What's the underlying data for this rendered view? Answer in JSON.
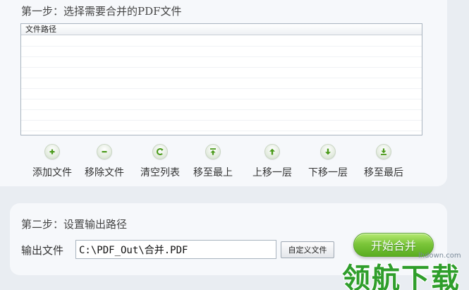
{
  "step1": {
    "title": "第一步：选择需要合并的PDF文件",
    "list": {
      "column_header": "文件路径",
      "rows": []
    },
    "actions": [
      {
        "icon": "plus-icon",
        "label": "添加文件"
      },
      {
        "icon": "minus-icon",
        "label": "移除文件"
      },
      {
        "icon": "refresh-icon",
        "label": "清空列表"
      },
      {
        "icon": "arrow-to-top-icon",
        "label": "移至最上"
      },
      {
        "icon": "arrow-up-icon",
        "label": "上移一层"
      },
      {
        "icon": "arrow-down-icon",
        "label": "下移一层"
      },
      {
        "icon": "arrow-to-bottom-icon",
        "label": "移至最后"
      }
    ]
  },
  "step2": {
    "title": "第二步：设置输出路径",
    "output_label": "输出文件",
    "output_path": "C:\\PDF_Out\\合并.PDF",
    "browse_label": "自定义文件",
    "start_label": "开始合并"
  },
  "watermark": {
    "brand": "领航下载",
    "domain": "lhdown.com"
  },
  "colors": {
    "accent_green": "#5aad21",
    "icon_green": "#4a9a1a",
    "panel_bg": "#f6f8fb",
    "page_bg": "#e9edf2"
  }
}
